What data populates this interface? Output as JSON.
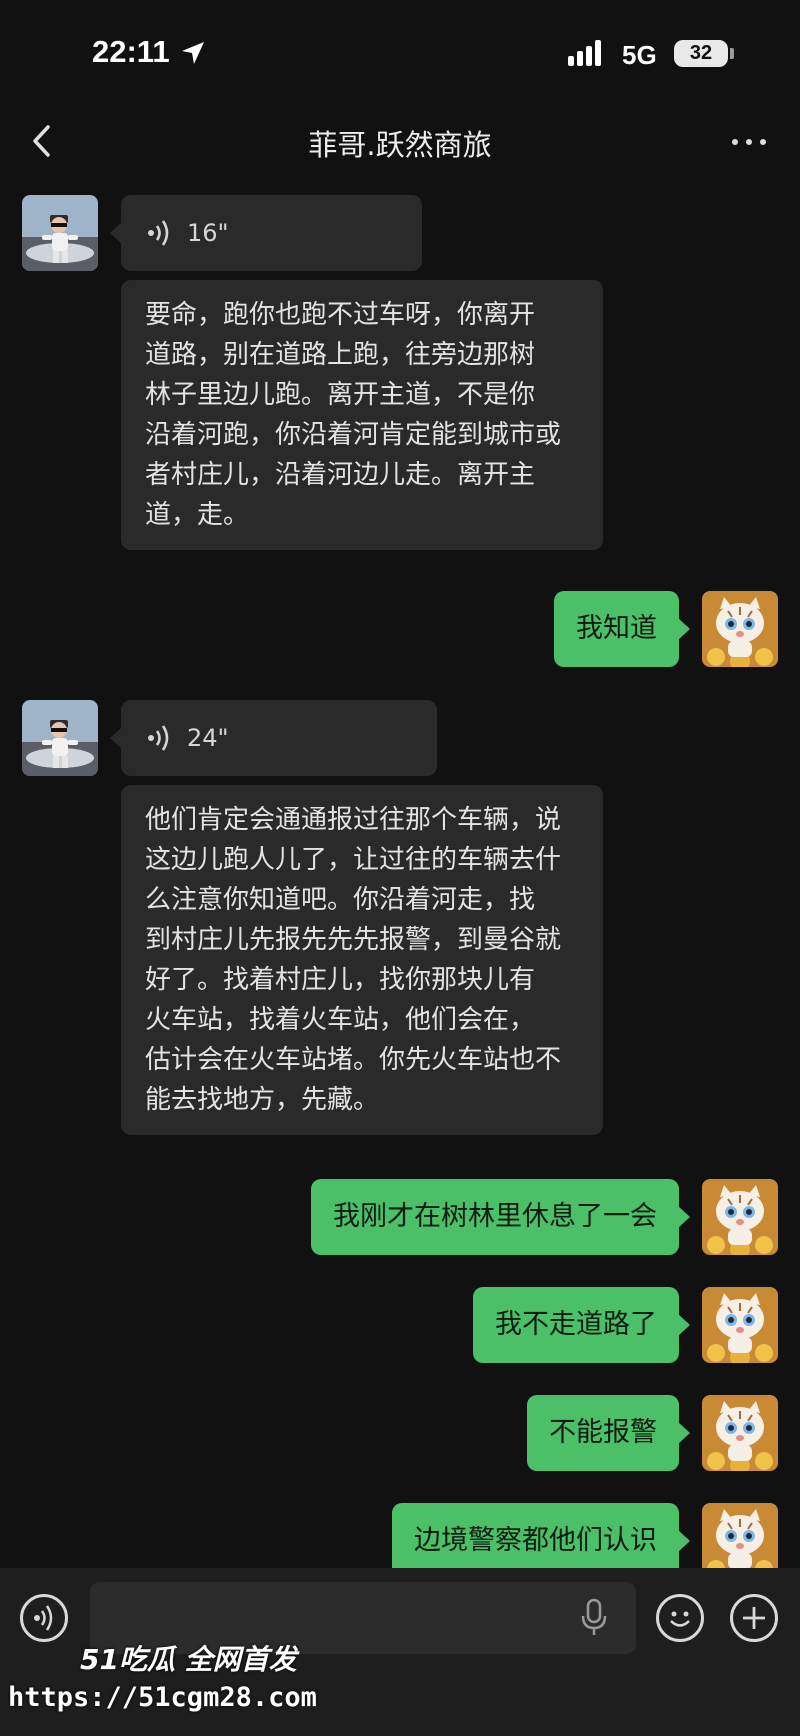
{
  "status_bar": {
    "time": "22:11",
    "network": "5G",
    "battery": "32"
  },
  "header": {
    "title": "菲哥.跃然商旅",
    "back_icon": "chevron-left-icon",
    "more_icon": "more-dots-icon"
  },
  "messages": [
    {
      "from": "contact",
      "type": "voice",
      "duration": "16\""
    },
    {
      "from": "contact",
      "type": "text",
      "text": "要命，跑你也跑不过车呀，你离开\n道路，别在道路上跑，往旁边那树\n林子里边儿跑。离开主道，不是你\n沿着河跑，你沿着河肯定能到城市或\n者村庄儿，沿着河边儿走。离开主\n道，走。"
    },
    {
      "from": "me",
      "type": "text",
      "text": "我知道"
    },
    {
      "from": "contact",
      "type": "voice",
      "duration": "24\""
    },
    {
      "from": "contact",
      "type": "text",
      "text": "他们肯定会通通报过往那个车辆，说\n这边儿跑人儿了，让过往的车辆去什\n么注意你知道吧。你沿着河走，找\n到村庄儿先报先先先报警，到曼谷就\n好了。找着村庄儿，找你那块儿有\n火车站，找着火车站，他们会在，\n估计会在火车站堵。你先火车站也不\n能去找地方，先藏。"
    },
    {
      "from": "me",
      "type": "text",
      "text": "我刚才在树林里休息了一会"
    },
    {
      "from": "me",
      "type": "text",
      "text": "我不走道路了"
    },
    {
      "from": "me",
      "type": "text",
      "text": "不能报警"
    },
    {
      "from": "me",
      "type": "text",
      "text": "边境警察都他们认识"
    }
  ],
  "input_bar": {
    "placeholder": "",
    "icons": [
      "voice-toggle-icon",
      "microphone-icon",
      "emoji-icon",
      "plus-icon"
    ]
  },
  "watermark": {
    "brand": "51吃瓜 全网首发",
    "url": "https://51cgm28.com"
  },
  "colors": {
    "background": "#111111",
    "incoming_bubble": "#2a2a2a",
    "outgoing_bubble": "#4bc069"
  }
}
